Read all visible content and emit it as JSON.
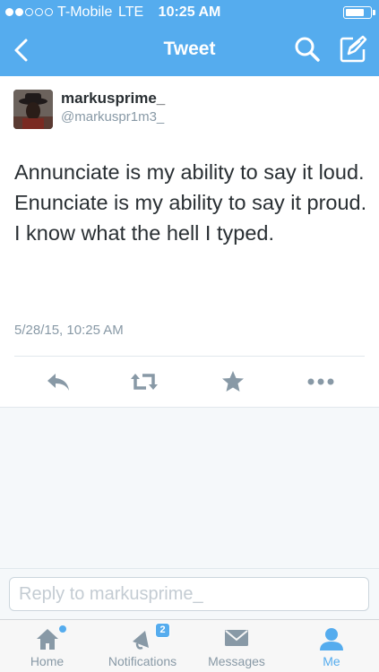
{
  "status_bar": {
    "carrier": "T-Mobile",
    "network": "LTE",
    "time": "10:25 AM",
    "battery_level": 0.85
  },
  "nav": {
    "title": "Tweet",
    "back_icon": "chevron-left-icon",
    "search_icon": "search-icon",
    "compose_icon": "compose-icon"
  },
  "tweet": {
    "display_name": "markusprime_",
    "handle": "@markuspr1m3_",
    "text_lines": [
      "Annunciate is my ability to say it loud.",
      "Enunciate is my ability to say it proud.",
      "I know what the hell I typed."
    ],
    "timestamp": "5/28/15, 10:25 AM",
    "actions": [
      "reply-icon",
      "retweet-icon",
      "favorite-icon",
      "more-icon"
    ]
  },
  "reply": {
    "placeholder": "Reply to markusprime_",
    "value": ""
  },
  "tabbar": {
    "tabs": [
      {
        "label": "Home",
        "icon": "home-icon",
        "active": false,
        "has_dot": true
      },
      {
        "label": "Notifications",
        "icon": "notifications-icon",
        "active": false,
        "badge": "2"
      },
      {
        "label": "Messages",
        "icon": "messages-icon",
        "active": false
      },
      {
        "label": "Me",
        "icon": "me-icon",
        "active": true
      }
    ]
  },
  "colors": {
    "brand": "#55acee",
    "text": "#292f33",
    "secondary": "#8899a6",
    "action_icon": "#8899a6"
  }
}
